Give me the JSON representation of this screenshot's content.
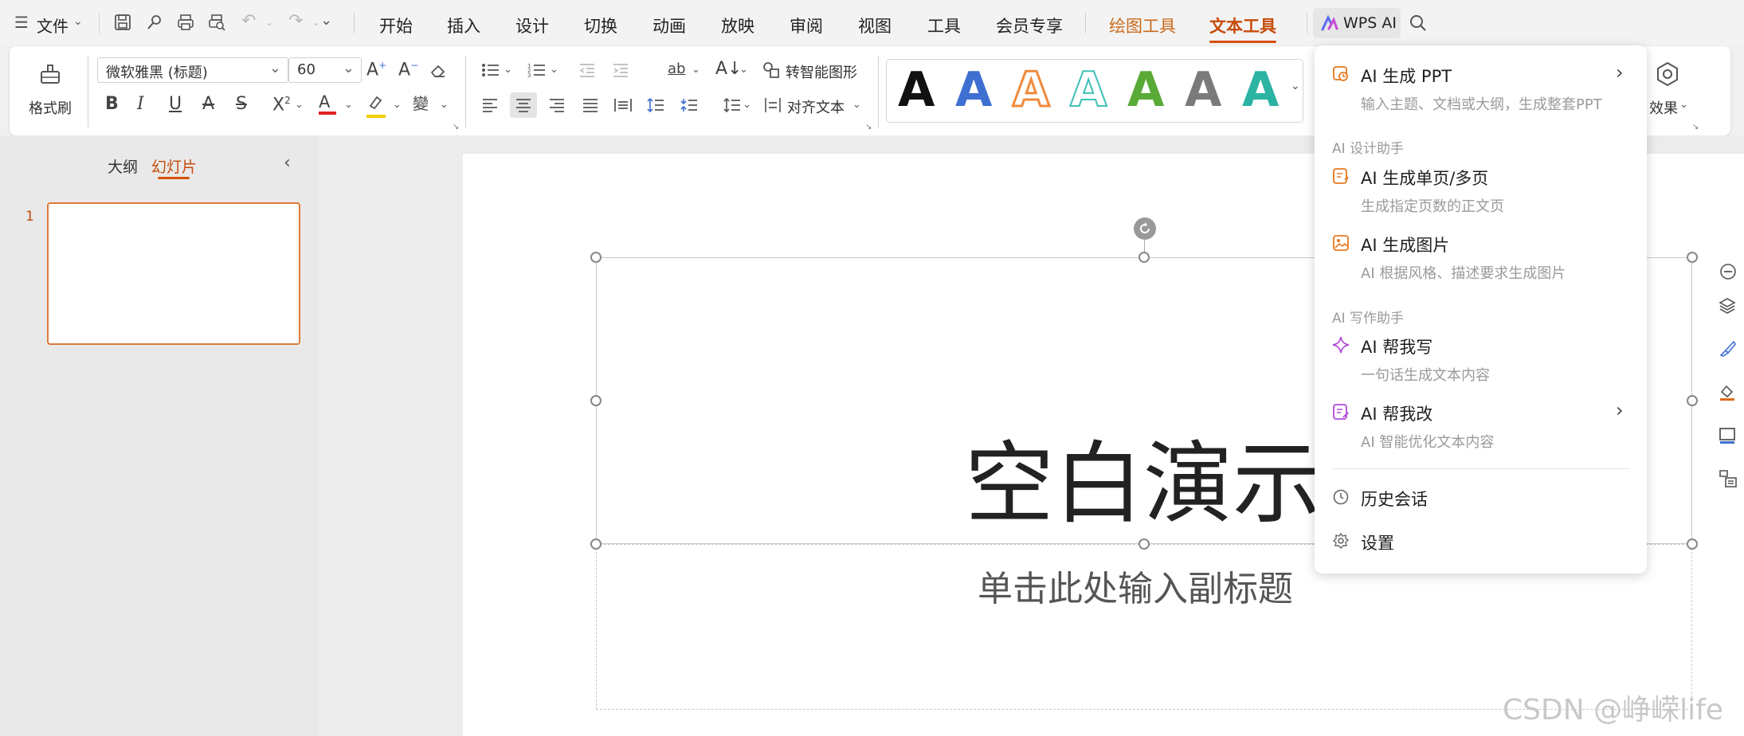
{
  "menubar": {
    "file_label": "文件",
    "tabs": [
      "开始",
      "插入",
      "设计",
      "切换",
      "动画",
      "放映",
      "审阅",
      "视图",
      "工具",
      "会员专享"
    ],
    "context_tabs": [
      "绘图工具",
      "文本工具"
    ],
    "wps_ai_label": "WPS AI"
  },
  "ribbon": {
    "format_painter_label": "格式刷",
    "font_name": "微软雅黑 (标题)",
    "font_size": "60",
    "smart_shape_label": "转智能图形",
    "align_text_label": "对齐文本",
    "effects_label": "效果",
    "style_colors": [
      "#111111",
      "#3f6fd1",
      "#f08a3c",
      "#3fc1b6",
      "#5aaa38",
      "#7a7a7a",
      "#2bb3a3"
    ]
  },
  "left_pane": {
    "tab_outline": "大纲",
    "tab_slides": "幻灯片",
    "slide_number": "1"
  },
  "slide": {
    "title": "空白演示",
    "subtitle": "单击此处输入副标题"
  },
  "ai_menu": {
    "generate_ppt": {
      "title": "AI 生成 PPT",
      "desc": "输入主题、文档或大纲，生成整套PPT"
    },
    "section_design": "AI 设计助手",
    "generate_pages": {
      "title": "AI 生成单页/多页",
      "desc": "生成指定页数的正文页"
    },
    "generate_image": {
      "title": "AI 生成图片",
      "desc": "AI 根据风格、描述要求生成图片"
    },
    "section_writing": "AI 写作助手",
    "help_write": {
      "title": "AI 帮我写",
      "desc": "一句话生成文本内容"
    },
    "help_edit": {
      "title": "AI 帮我改",
      "desc": "AI 智能优化文本内容"
    },
    "history_label": "历史会话",
    "settings_label": "设置"
  },
  "watermark": "CSDN @峥嵘life",
  "colors": {
    "accent": "#d4520d",
    "context_tab": "#c96a1a"
  }
}
